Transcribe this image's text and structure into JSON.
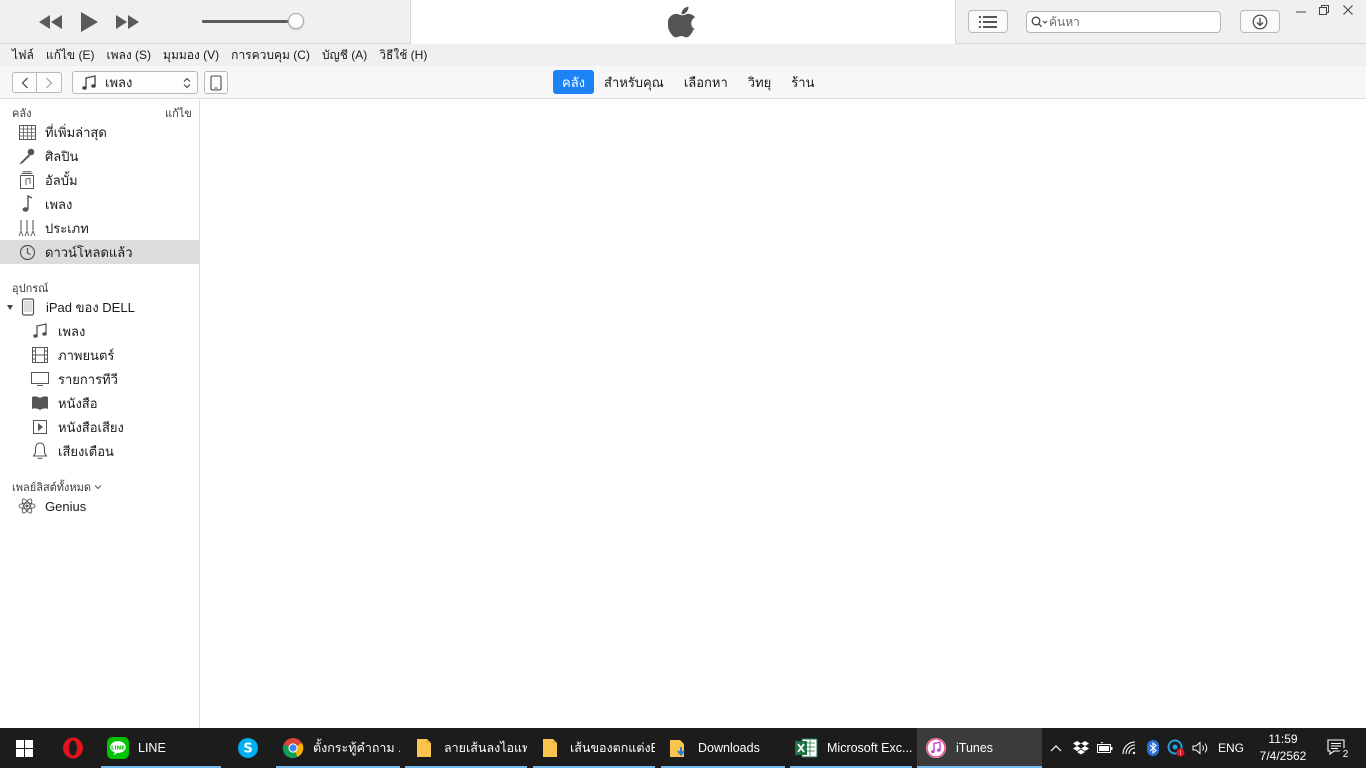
{
  "window": {
    "title": "iTunes",
    "minimize_icon": "minimize-icon",
    "maximize_icon": "restore-icon",
    "close_icon": "close-icon"
  },
  "player": {
    "volume_percent": 90,
    "search_placeholder": "ค้นหา"
  },
  "menu": [
    "ไฟล์",
    "แก้ไข (E)",
    "เพลง (S)",
    "มุมมอง (V)",
    "การควบคุม (C)",
    "บัญชี (A)",
    "วิธีใช้ (H)"
  ],
  "nav": {
    "media_type": "เพลง",
    "tabs": [
      {
        "label": "คลัง",
        "active": true
      },
      {
        "label": "สำหรับคุณ",
        "active": false
      },
      {
        "label": "เลือกหา",
        "active": false
      },
      {
        "label": "วิทยุ",
        "active": false
      },
      {
        "label": "ร้าน",
        "active": false
      }
    ]
  },
  "sidebar": {
    "library_header": "คลัง",
    "edit_label": "แก้ไข",
    "library_items": [
      {
        "label": "ที่เพิ่มล่าสุด",
        "icon": "grid-icon"
      },
      {
        "label": "ศิลปิน",
        "icon": "microphone-icon"
      },
      {
        "label": "อัลบั้ม",
        "icon": "album-icon"
      },
      {
        "label": "เพลง",
        "icon": "music-note-icon"
      },
      {
        "label": "ประเภท",
        "icon": "genre-icon"
      },
      {
        "label": "ดาวน์โหลดแล้ว",
        "icon": "clock-icon",
        "selected": true
      }
    ],
    "devices_header": "อุปกรณ์",
    "device_name": "iPad ของ DELL",
    "device_items": [
      {
        "label": "เพลง",
        "icon": "music-note-icon"
      },
      {
        "label": "ภาพยนตร์",
        "icon": "film-icon"
      },
      {
        "label": "รายการทีวี",
        "icon": "tv-icon"
      },
      {
        "label": "หนังสือ",
        "icon": "book-icon"
      },
      {
        "label": "หนังสือเสียง",
        "icon": "audiobook-icon"
      },
      {
        "label": "เสียงเตือน",
        "icon": "bell-icon"
      }
    ],
    "playlists_header": "เพลย์ลิสต์ทั้งหมด",
    "playlists": [
      {
        "label": "Genius",
        "icon": "genius-icon"
      }
    ]
  },
  "taskbar": {
    "apps": [
      {
        "label": "",
        "icon": "opera-icon"
      },
      {
        "label": "LINE",
        "icon": "line-icon"
      },
      {
        "label": "",
        "icon": "skype-icon"
      },
      {
        "label": "ตั้งกระทู้คำถาม ...",
        "icon": "chrome-icon"
      },
      {
        "label": "ลายเส้นลงไอแพด",
        "icon": "folder-icon"
      },
      {
        "label": "เส้นของตกแต่งB...",
        "icon": "folder-icon"
      },
      {
        "label": "Downloads",
        "icon": "downloads-folder-icon"
      },
      {
        "label": "Microsoft Exc...",
        "icon": "excel-icon"
      },
      {
        "label": "iTunes",
        "icon": "itunes-icon"
      }
    ],
    "language": "ENG",
    "time": "11:59",
    "date": "7/4/2562",
    "notification_count": "2"
  }
}
